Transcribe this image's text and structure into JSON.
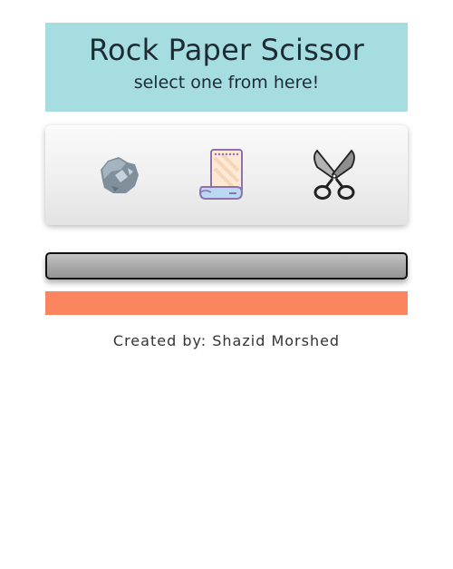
{
  "header": {
    "title": "Rock Paper Scissor",
    "subtitle": "select one from here!",
    "background_color": "#a6dde0"
  },
  "choices": [
    {
      "name": "rock",
      "icon": "rock-icon"
    },
    {
      "name": "paper",
      "icon": "paper-icon"
    },
    {
      "name": "scissor",
      "icon": "scissors-icon"
    }
  ],
  "result": {
    "text": ""
  },
  "score": {
    "text": "",
    "color": "#fb855e"
  },
  "footer": {
    "credit": "Created by: Shazid Morshed"
  }
}
